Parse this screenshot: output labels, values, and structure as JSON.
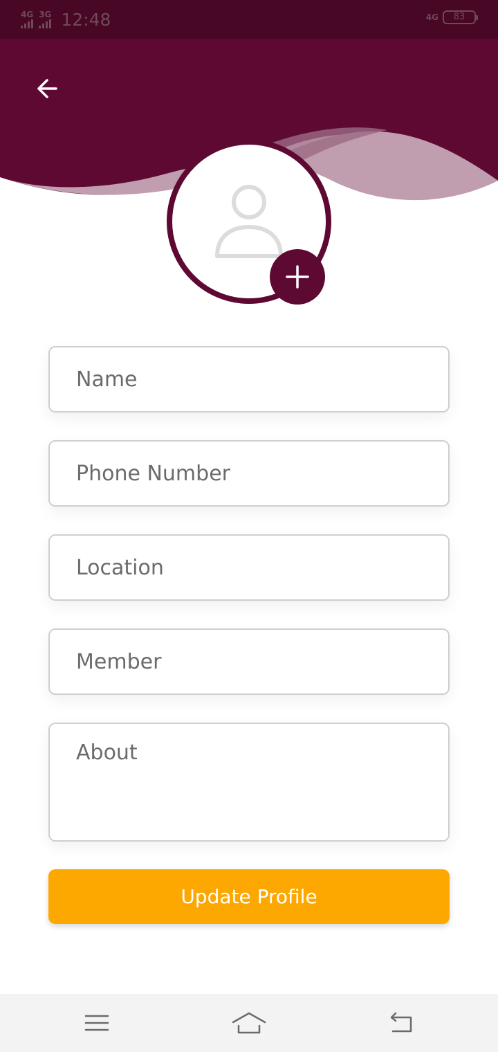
{
  "status_bar": {
    "signal1_label": "4G",
    "signal2_label": "3G",
    "time": "12:48",
    "network_right": "4G",
    "battery": "83"
  },
  "header": {
    "back_icon": "arrow-left-icon",
    "colors": {
      "primary": "#5e0932",
      "wave_light": "#c09daf",
      "status_bar": "#470725"
    }
  },
  "avatar": {
    "placeholder_icon": "user-placeholder-icon",
    "add_icon": "plus-icon"
  },
  "form": {
    "name_placeholder": "Name",
    "phone_placeholder": "Phone Number",
    "location_placeholder": "Location",
    "member_placeholder": "Member",
    "about_placeholder": "About",
    "submit_label": "Update Profile",
    "submit_color": "#fda800"
  },
  "nav_bar": {
    "menu_icon": "menu-icon",
    "home_icon": "home-icon",
    "back_icon": "back-icon"
  }
}
